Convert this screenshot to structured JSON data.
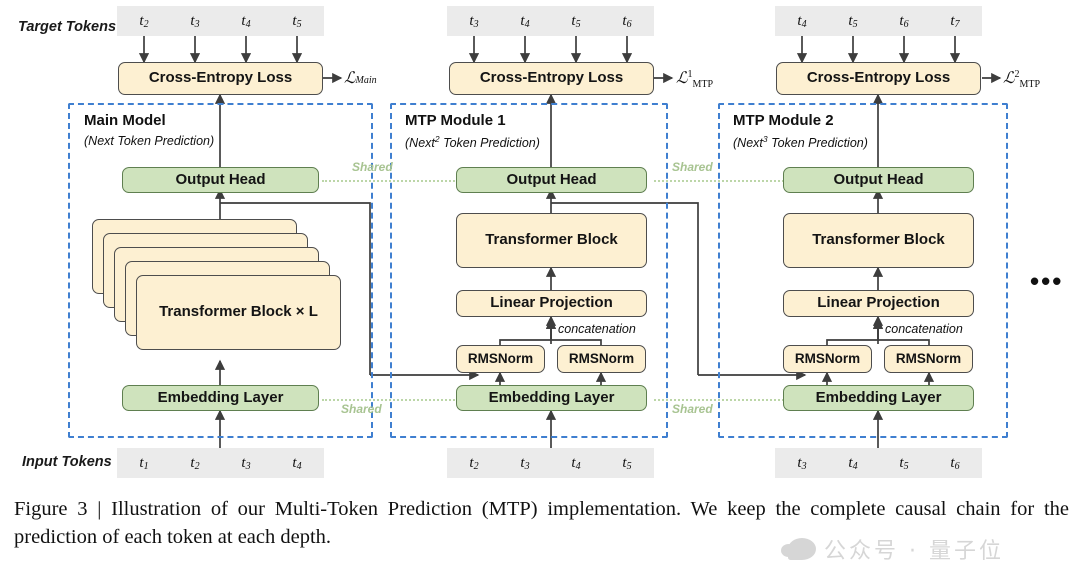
{
  "figure": {
    "caption": "Figure 3 | Illustration of our Multi-Token Prediction (MTP) implementation.  We keep the complete causal chain for the prediction of each token at each depth.",
    "row_labels": {
      "target": "Target Tokens",
      "input": "Input Tokens"
    },
    "ellipsis": "•••",
    "shared_label": "Shared",
    "concatenation_label": "concatenation"
  },
  "colors": {
    "cream_fill": "#fdf0d2",
    "cream_border": "#4d4d4d",
    "green_fill": "#cfe3bd",
    "green_border": "#5f7f50",
    "frame_dashed": "#3f7fd0",
    "token_fill": "#ebebeb",
    "shared_dotted": "#bcd6a8",
    "wire": "#3d3d3d"
  },
  "columns": [
    {
      "id": "main",
      "title": "Main Model",
      "subtitle": "(Next Token Prediction)",
      "target_tokens": [
        "t2",
        "t3",
        "t4",
        "t5"
      ],
      "input_tokens": [
        "t1",
        "t2",
        "t3",
        "t4"
      ],
      "loss": {
        "symbol": "L",
        "sub": "Main",
        "sup": ""
      },
      "loss_text": "L_Main",
      "nodes": {
        "ce_loss": "Cross-Entropy Loss",
        "output_head": "Output Head",
        "transformer": "Transformer Block × L",
        "embedding": "Embedding Layer"
      }
    },
    {
      "id": "mtp1",
      "title": "MTP Module 1",
      "subtitle_pre": "(Next",
      "subtitle_sup": "2",
      "subtitle_post": " Token Prediction)",
      "subtitle": "(Next2 Token Prediction)",
      "target_tokens": [
        "t3",
        "t4",
        "t5",
        "t6"
      ],
      "input_tokens": [
        "t2",
        "t3",
        "t4",
        "t5"
      ],
      "loss": {
        "symbol": "L",
        "sub": "MTP",
        "sup": "1"
      },
      "loss_text": "L^1_MTP",
      "nodes": {
        "ce_loss": "Cross-Entropy Loss",
        "output_head": "Output Head",
        "transformer": "Transformer Block",
        "linear": "Linear Projection",
        "rmsnorm_left": "RMSNorm",
        "rmsnorm_right": "RMSNorm",
        "embedding": "Embedding Layer"
      }
    },
    {
      "id": "mtp2",
      "title": "MTP Module 2",
      "subtitle_pre": "(Next",
      "subtitle_sup": "3",
      "subtitle_post": " Token Prediction)",
      "subtitle": "(Next3 Token Prediction)",
      "target_tokens": [
        "t4",
        "t5",
        "t6",
        "t7"
      ],
      "input_tokens": [
        "t3",
        "t4",
        "t5",
        "t6"
      ],
      "loss": {
        "symbol": "L",
        "sub": "MTP",
        "sup": "2"
      },
      "loss_text": "L^2_MTP",
      "nodes": {
        "ce_loss": "Cross-Entropy Loss",
        "output_head": "Output Head",
        "transformer": "Transformer Block",
        "linear": "Linear Projection",
        "rmsnorm_left": "RMSNorm",
        "rmsnorm_right": "RMSNorm",
        "embedding": "Embedding Layer"
      }
    }
  ],
  "watermark": {
    "text": "公众号 · 量子位"
  }
}
